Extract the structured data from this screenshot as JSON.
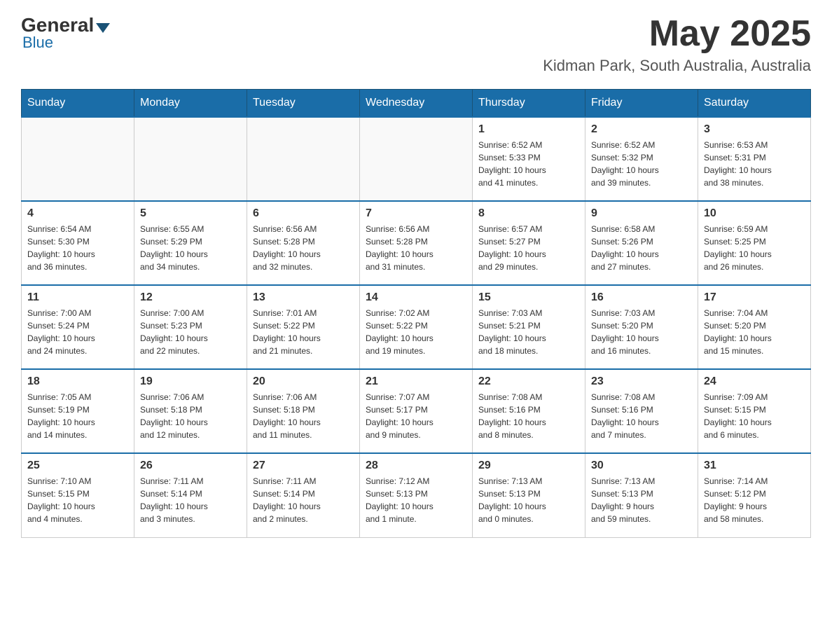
{
  "header": {
    "logo_general": "General",
    "logo_blue": "Blue",
    "month_title": "May 2025",
    "location": "Kidman Park, South Australia, Australia"
  },
  "weekdays": [
    "Sunday",
    "Monday",
    "Tuesday",
    "Wednesday",
    "Thursday",
    "Friday",
    "Saturday"
  ],
  "weeks": [
    [
      {
        "day": "",
        "info": ""
      },
      {
        "day": "",
        "info": ""
      },
      {
        "day": "",
        "info": ""
      },
      {
        "day": "",
        "info": ""
      },
      {
        "day": "1",
        "info": "Sunrise: 6:52 AM\nSunset: 5:33 PM\nDaylight: 10 hours\nand 41 minutes."
      },
      {
        "day": "2",
        "info": "Sunrise: 6:52 AM\nSunset: 5:32 PM\nDaylight: 10 hours\nand 39 minutes."
      },
      {
        "day": "3",
        "info": "Sunrise: 6:53 AM\nSunset: 5:31 PM\nDaylight: 10 hours\nand 38 minutes."
      }
    ],
    [
      {
        "day": "4",
        "info": "Sunrise: 6:54 AM\nSunset: 5:30 PM\nDaylight: 10 hours\nand 36 minutes."
      },
      {
        "day": "5",
        "info": "Sunrise: 6:55 AM\nSunset: 5:29 PM\nDaylight: 10 hours\nand 34 minutes."
      },
      {
        "day": "6",
        "info": "Sunrise: 6:56 AM\nSunset: 5:28 PM\nDaylight: 10 hours\nand 32 minutes."
      },
      {
        "day": "7",
        "info": "Sunrise: 6:56 AM\nSunset: 5:28 PM\nDaylight: 10 hours\nand 31 minutes."
      },
      {
        "day": "8",
        "info": "Sunrise: 6:57 AM\nSunset: 5:27 PM\nDaylight: 10 hours\nand 29 minutes."
      },
      {
        "day": "9",
        "info": "Sunrise: 6:58 AM\nSunset: 5:26 PM\nDaylight: 10 hours\nand 27 minutes."
      },
      {
        "day": "10",
        "info": "Sunrise: 6:59 AM\nSunset: 5:25 PM\nDaylight: 10 hours\nand 26 minutes."
      }
    ],
    [
      {
        "day": "11",
        "info": "Sunrise: 7:00 AM\nSunset: 5:24 PM\nDaylight: 10 hours\nand 24 minutes."
      },
      {
        "day": "12",
        "info": "Sunrise: 7:00 AM\nSunset: 5:23 PM\nDaylight: 10 hours\nand 22 minutes."
      },
      {
        "day": "13",
        "info": "Sunrise: 7:01 AM\nSunset: 5:22 PM\nDaylight: 10 hours\nand 21 minutes."
      },
      {
        "day": "14",
        "info": "Sunrise: 7:02 AM\nSunset: 5:22 PM\nDaylight: 10 hours\nand 19 minutes."
      },
      {
        "day": "15",
        "info": "Sunrise: 7:03 AM\nSunset: 5:21 PM\nDaylight: 10 hours\nand 18 minutes."
      },
      {
        "day": "16",
        "info": "Sunrise: 7:03 AM\nSunset: 5:20 PM\nDaylight: 10 hours\nand 16 minutes."
      },
      {
        "day": "17",
        "info": "Sunrise: 7:04 AM\nSunset: 5:20 PM\nDaylight: 10 hours\nand 15 minutes."
      }
    ],
    [
      {
        "day": "18",
        "info": "Sunrise: 7:05 AM\nSunset: 5:19 PM\nDaylight: 10 hours\nand 14 minutes."
      },
      {
        "day": "19",
        "info": "Sunrise: 7:06 AM\nSunset: 5:18 PM\nDaylight: 10 hours\nand 12 minutes."
      },
      {
        "day": "20",
        "info": "Sunrise: 7:06 AM\nSunset: 5:18 PM\nDaylight: 10 hours\nand 11 minutes."
      },
      {
        "day": "21",
        "info": "Sunrise: 7:07 AM\nSunset: 5:17 PM\nDaylight: 10 hours\nand 9 minutes."
      },
      {
        "day": "22",
        "info": "Sunrise: 7:08 AM\nSunset: 5:16 PM\nDaylight: 10 hours\nand 8 minutes."
      },
      {
        "day": "23",
        "info": "Sunrise: 7:08 AM\nSunset: 5:16 PM\nDaylight: 10 hours\nand 7 minutes."
      },
      {
        "day": "24",
        "info": "Sunrise: 7:09 AM\nSunset: 5:15 PM\nDaylight: 10 hours\nand 6 minutes."
      }
    ],
    [
      {
        "day": "25",
        "info": "Sunrise: 7:10 AM\nSunset: 5:15 PM\nDaylight: 10 hours\nand 4 minutes."
      },
      {
        "day": "26",
        "info": "Sunrise: 7:11 AM\nSunset: 5:14 PM\nDaylight: 10 hours\nand 3 minutes."
      },
      {
        "day": "27",
        "info": "Sunrise: 7:11 AM\nSunset: 5:14 PM\nDaylight: 10 hours\nand 2 minutes."
      },
      {
        "day": "28",
        "info": "Sunrise: 7:12 AM\nSunset: 5:13 PM\nDaylight: 10 hours\nand 1 minute."
      },
      {
        "day": "29",
        "info": "Sunrise: 7:13 AM\nSunset: 5:13 PM\nDaylight: 10 hours\nand 0 minutes."
      },
      {
        "day": "30",
        "info": "Sunrise: 7:13 AM\nSunset: 5:13 PM\nDaylight: 9 hours\nand 59 minutes."
      },
      {
        "day": "31",
        "info": "Sunrise: 7:14 AM\nSunset: 5:12 PM\nDaylight: 9 hours\nand 58 minutes."
      }
    ]
  ]
}
